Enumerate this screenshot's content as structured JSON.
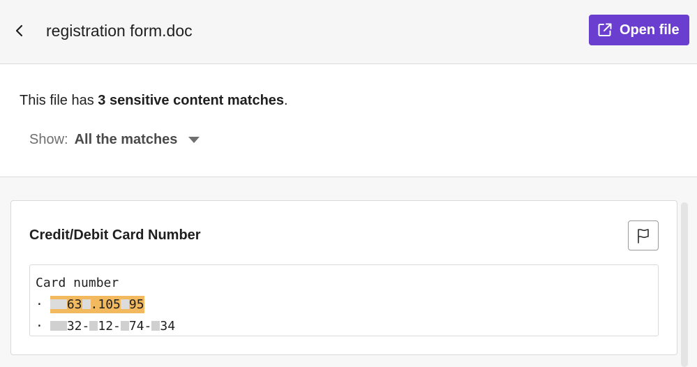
{
  "header": {
    "file_name": "registration form.doc",
    "open_button_label": "Open file"
  },
  "summary": {
    "prefix": "This file has ",
    "count_text": "3 sensitive content matches",
    "suffix": "."
  },
  "filter": {
    "label": "Show:",
    "selected": "All the matches"
  },
  "match_card": {
    "title": "Credit/Debit Card Number",
    "snippet_heading": "Card number",
    "bullet": "·",
    "match_1_parts": [
      "",
      "63",
      ".105",
      "95"
    ],
    "match_2_parts": [
      "",
      "32-",
      "12-",
      "74-",
      "34"
    ]
  },
  "colors": {
    "accent": "#6a3fd0",
    "highlight": "#f3b95f"
  }
}
